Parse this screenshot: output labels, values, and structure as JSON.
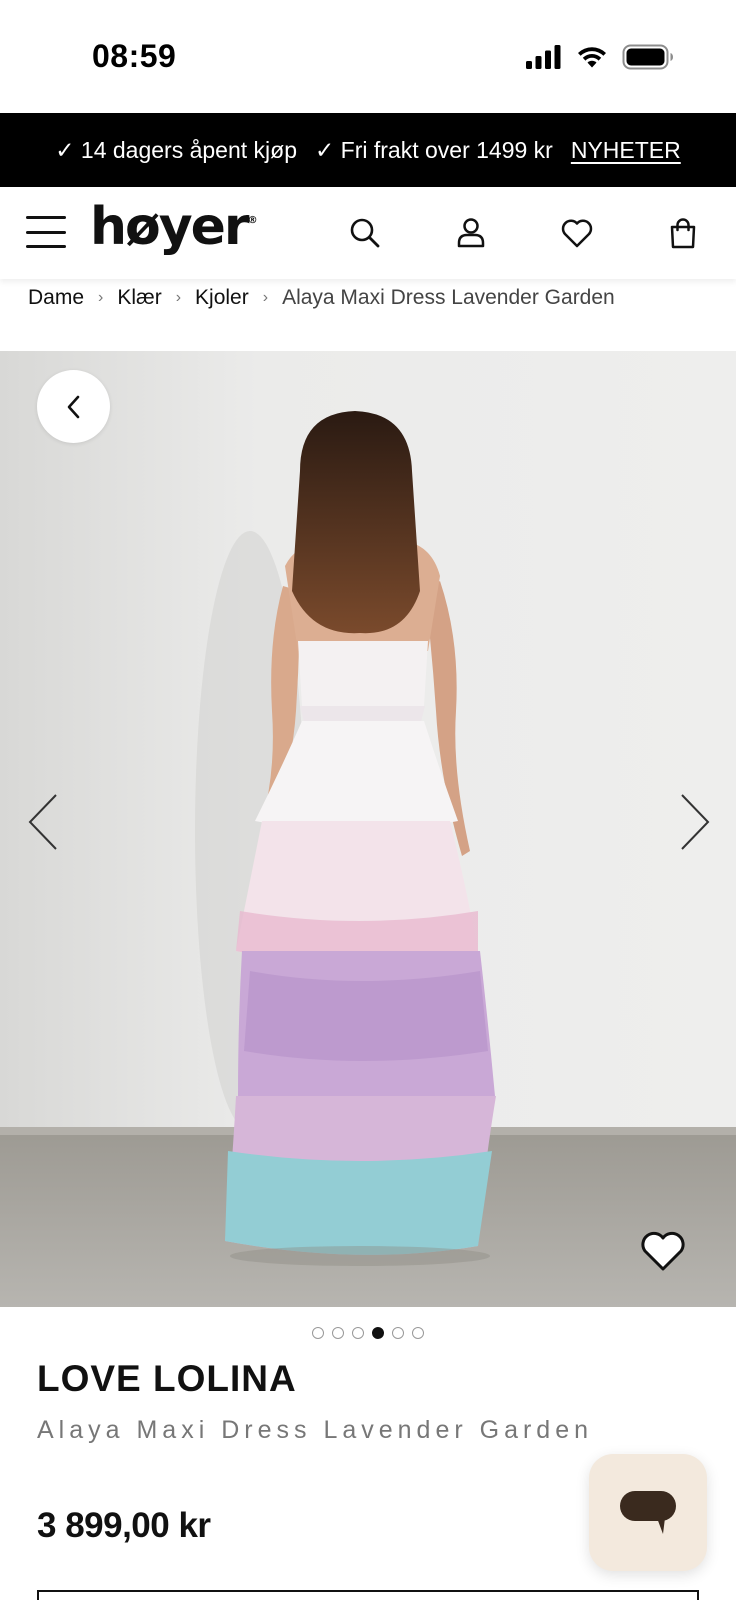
{
  "status_bar": {
    "time": "08:59"
  },
  "promo": {
    "items": [
      "✓ 14 dagers åpent kjøp",
      "✓ Fri frakt over 1499 kr"
    ],
    "link": "NYHETER"
  },
  "header": {
    "logo": "høyer",
    "logo_mark": "®"
  },
  "breadcrumb": {
    "items": [
      "Dame",
      "Klær",
      "Kjoler"
    ],
    "current": "Alaya Maxi Dress Lavender Garden",
    "separator": "›"
  },
  "gallery": {
    "image_count": 6,
    "active_index": 3
  },
  "product": {
    "brand": "LOVE LOLINA",
    "name": "Alaya Maxi Dress Lavender Garden",
    "price": "3 899,00 kr"
  },
  "colors": {
    "promo_bg": "#000000",
    "chat_bg": "#f3e9dd",
    "chat_icon": "#3a2a1e",
    "wall": "#ebebea",
    "floor": "#a9a6a0"
  }
}
